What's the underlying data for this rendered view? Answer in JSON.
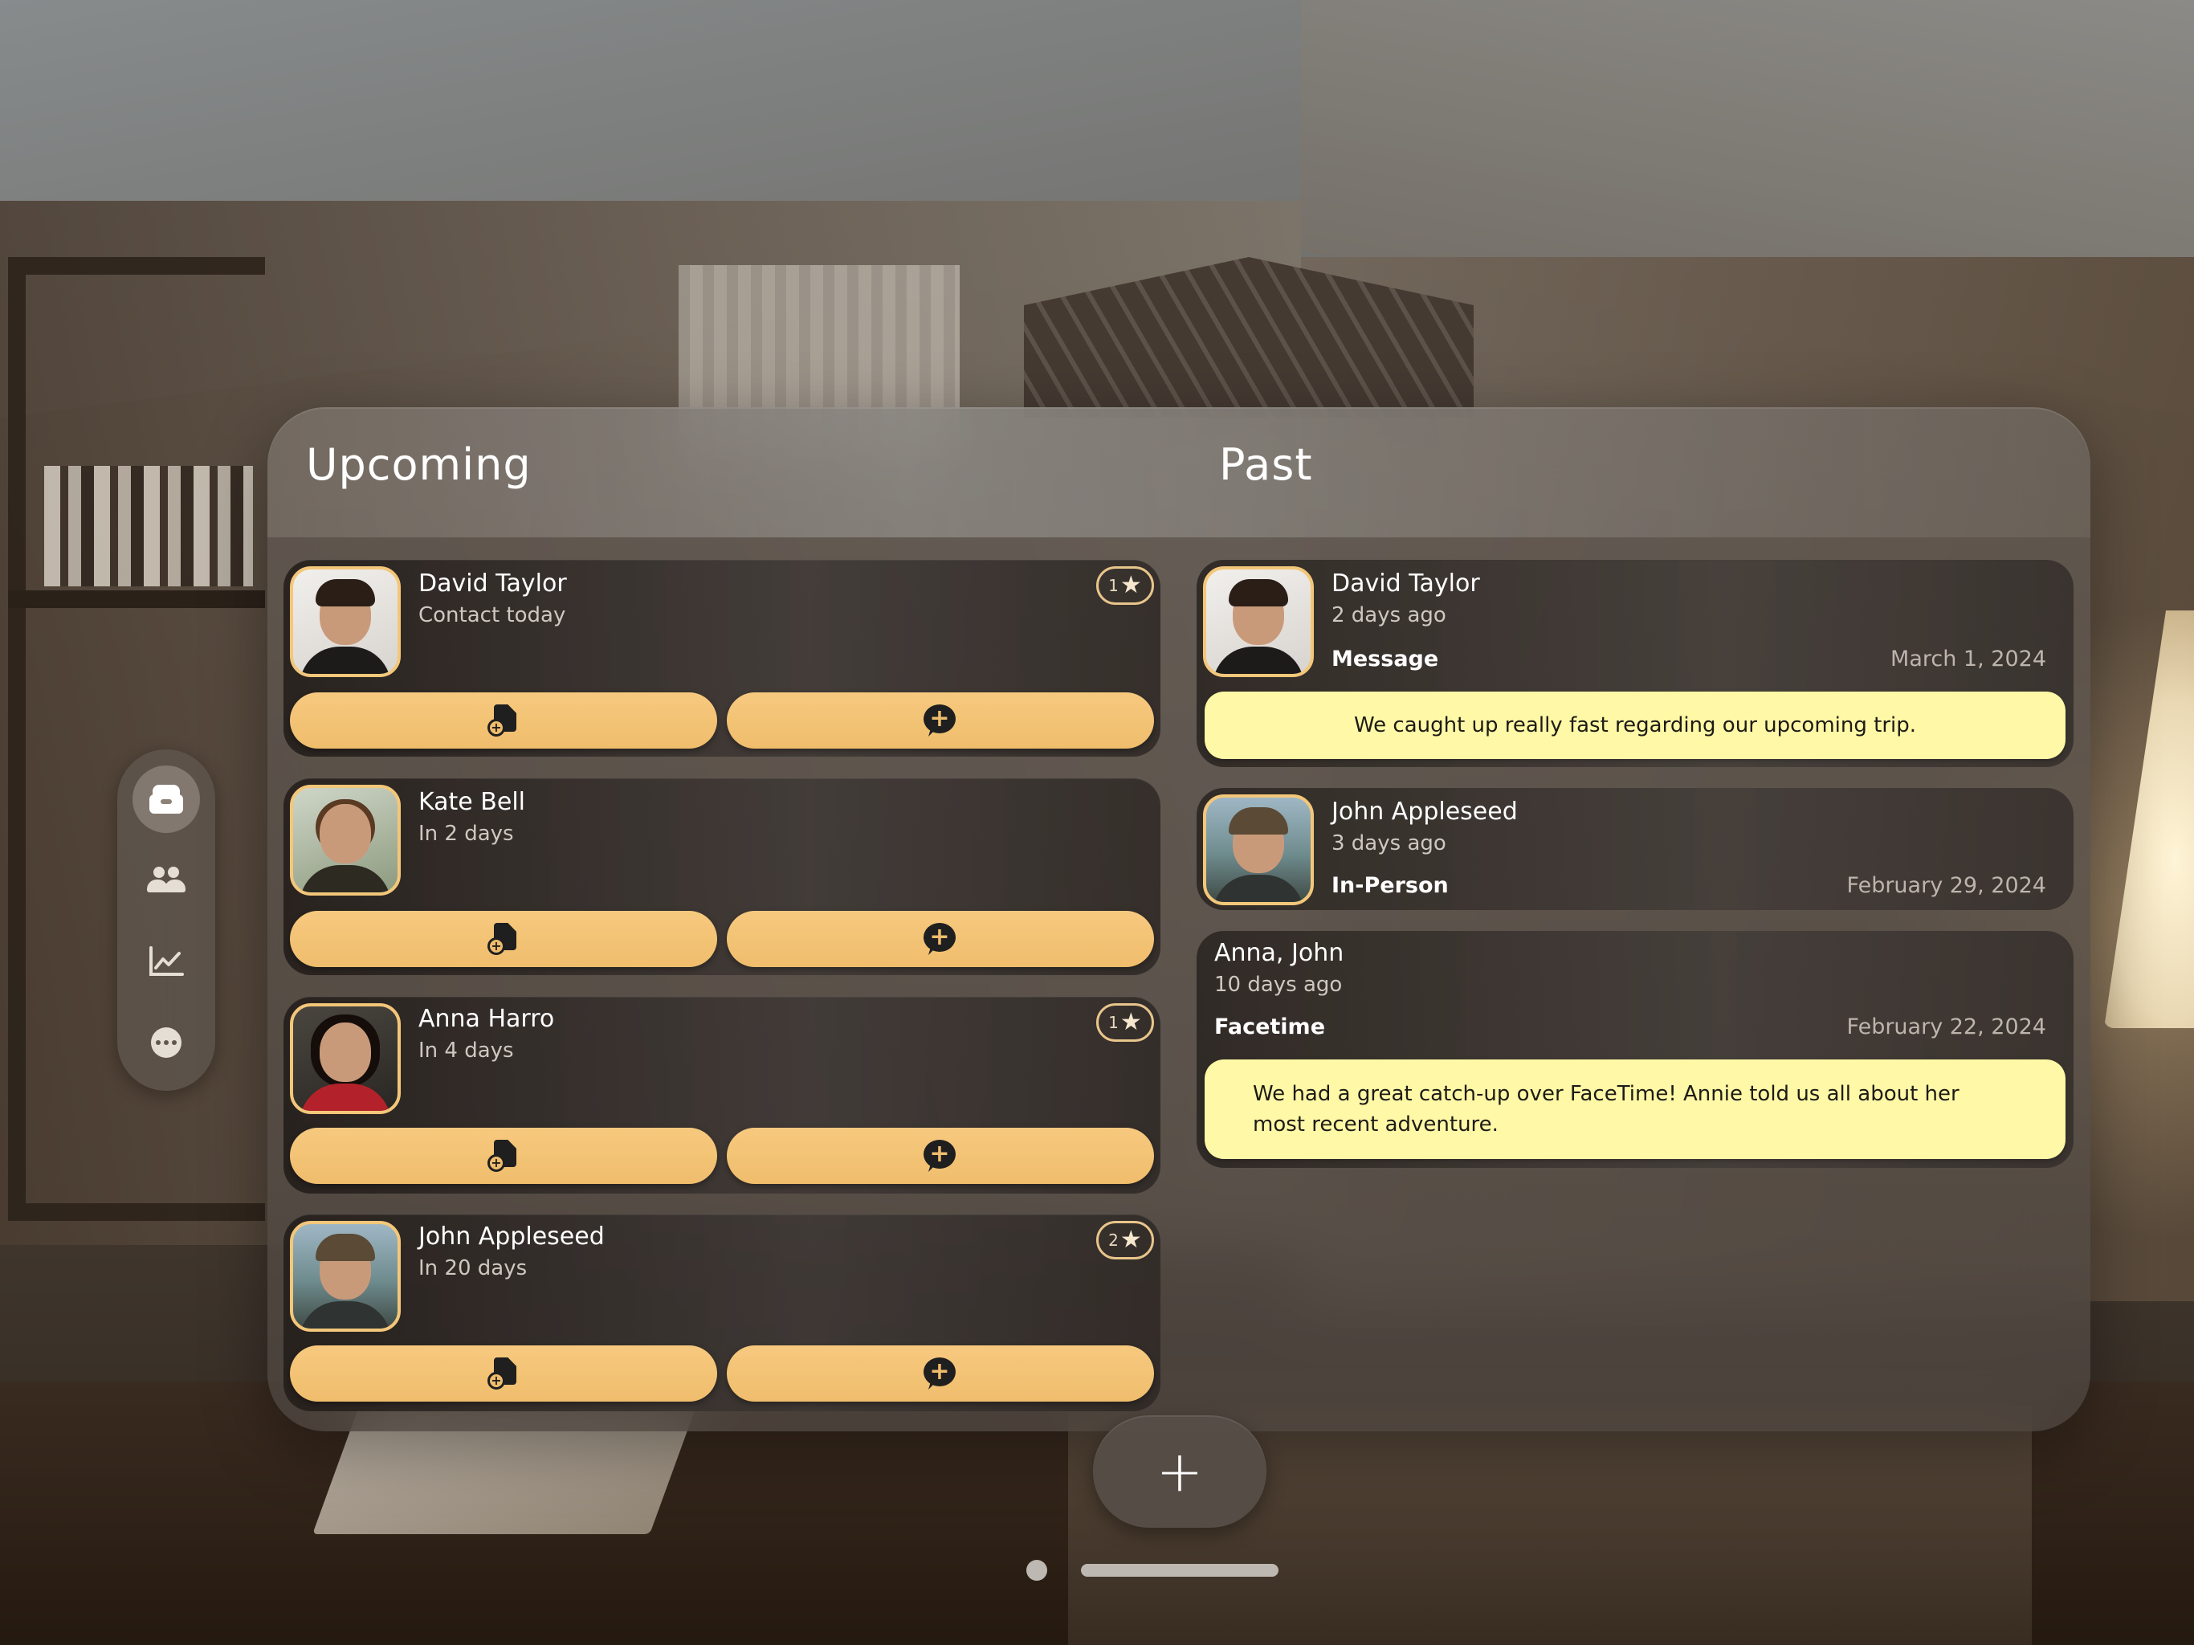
{
  "sections": {
    "upcoming_title": "Upcoming",
    "past_title": "Past"
  },
  "upcoming": [
    {
      "name": "David Taylor",
      "subtitle": "Contact today",
      "star_count": "1",
      "avatar": "david-taylor-photo"
    },
    {
      "name": "Kate Bell",
      "subtitle": "In 2 days",
      "star_count": "",
      "avatar": "kate-bell-photo"
    },
    {
      "name": "Anna Harro",
      "subtitle": "In 4 days",
      "star_count": "1",
      "avatar": "anna-harro-photo"
    },
    {
      "name": "John Appleseed",
      "subtitle": "In 20 days",
      "star_count": "2",
      "avatar": "john-appleseed-photo"
    }
  ],
  "past": [
    {
      "name": "David Taylor",
      "subtitle": "2 days ago",
      "type": "Message",
      "date": "March 1, 2024",
      "note": "We caught up really fast regarding our upcoming trip."
    },
    {
      "name": "John Appleseed",
      "subtitle": "3 days ago",
      "type": "In-Person",
      "date": "February 29, 2024",
      "note": ""
    },
    {
      "name": "Anna, John",
      "subtitle": "10 days ago",
      "type": "Facetime",
      "date": "February 22, 2024",
      "note": "We had a great catch-up over FaceTime! Annie told us all about her most recent adventure."
    }
  ],
  "icons": {
    "add_note": "note-plus-icon",
    "add_message": "bubble-plus-icon",
    "star": "star-icon",
    "sidebar": [
      "tray-icon",
      "people-icon",
      "chart-icon",
      "more-icon"
    ]
  },
  "add_button_label": "+",
  "colors": {
    "accent": "#efbd6c",
    "note_background": "#fff8a6",
    "avatar_border": "#f3c77a"
  }
}
